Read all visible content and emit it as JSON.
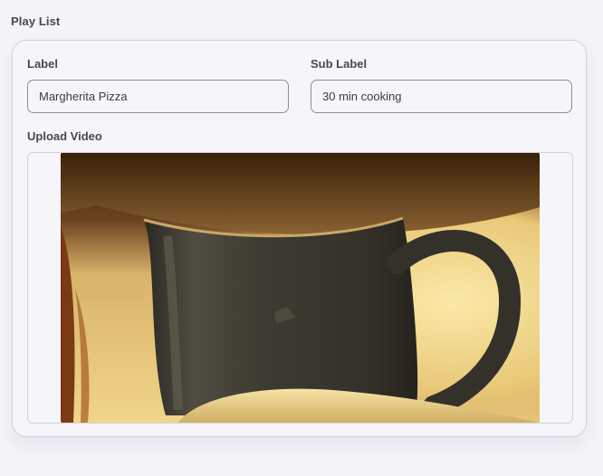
{
  "section": {
    "title": "Play List"
  },
  "form": {
    "label": {
      "title": "Label",
      "value": "Margherita Pizza"
    },
    "sub_label": {
      "title": "Sub Label",
      "value": "30 min cooking"
    },
    "upload": {
      "title": "Upload Video",
      "thumbnail_icon": "video-thumbnail"
    }
  }
}
